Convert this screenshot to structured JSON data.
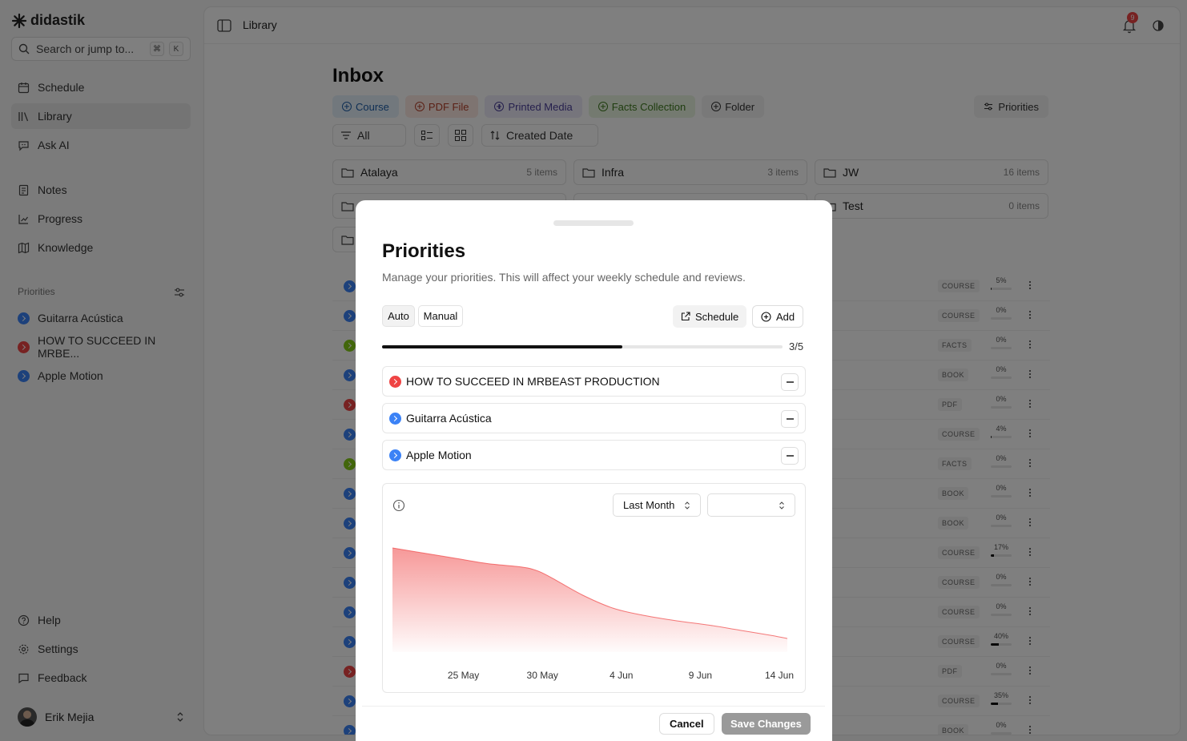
{
  "app": {
    "name": "didastik"
  },
  "sidebar": {
    "search_placeholder": "Search or jump to...",
    "shortcut": [
      "⌘",
      "K"
    ],
    "nav": [
      {
        "label": "Schedule"
      },
      {
        "label": "Library"
      },
      {
        "label": "Ask AI"
      },
      {
        "label": "Notes"
      },
      {
        "label": "Progress"
      },
      {
        "label": "Knowledge"
      }
    ],
    "priorities_label": "Priorities",
    "priorities": [
      {
        "label": "Guitarra Acústica",
        "color": "#3b82f6"
      },
      {
        "label": "HOW TO SUCCEED IN MRBE...",
        "color": "#ef4444"
      },
      {
        "label": "Apple Motion",
        "color": "#3b82f6"
      }
    ],
    "footer": [
      {
        "label": "Help"
      },
      {
        "label": "Settings"
      },
      {
        "label": "Feedback"
      }
    ],
    "user": {
      "name": "Erik Mejia"
    }
  },
  "main": {
    "breadcrumb": "Library",
    "notifications_count": "9",
    "title": "Inbox",
    "add_chips": [
      "Course",
      "PDF File",
      "Printed Media",
      "Facts Collection",
      "Folder"
    ],
    "priorities_button": "Priorities",
    "filter": {
      "label": "All",
      "sort": "Created Date"
    },
    "folders": [
      {
        "name": "Atalaya",
        "count": "5 items"
      },
      {
        "name": "Infra",
        "count": "3 items"
      },
      {
        "name": "JW",
        "count": "16 items"
      },
      {
        "name": "Test",
        "count": "0 items"
      }
    ],
    "rows": [
      {
        "tag": "COURSE",
        "pct": "5%",
        "progress": 5,
        "color": "#3b82f6"
      },
      {
        "tag": "COURSE",
        "pct": "0%",
        "progress": 0,
        "color": "#3b82f6"
      },
      {
        "tag": "FACTS",
        "pct": "0%",
        "progress": 0,
        "color": "#84cc16"
      },
      {
        "tag": "BOOK",
        "pct": "0%",
        "progress": 0,
        "color": "#3b82f6"
      },
      {
        "tag": "PDF",
        "pct": "0%",
        "progress": 0,
        "color": "#ef4444"
      },
      {
        "tag": "COURSE",
        "pct": "4%",
        "progress": 4,
        "color": "#3b82f6"
      },
      {
        "tag": "FACTS",
        "pct": "0%",
        "progress": 0,
        "color": "#84cc16"
      },
      {
        "tag": "BOOK",
        "pct": "0%",
        "progress": 0,
        "color": "#3b82f6"
      },
      {
        "tag": "BOOK",
        "pct": "0%",
        "progress": 0,
        "color": "#3b82f6"
      },
      {
        "tag": "COURSE",
        "pct": "17%",
        "progress": 17,
        "color": "#3b82f6"
      },
      {
        "tag": "COURSE",
        "pct": "0%",
        "progress": 0,
        "color": "#3b82f6"
      },
      {
        "tag": "COURSE",
        "pct": "0%",
        "progress": 0,
        "color": "#3b82f6"
      },
      {
        "tag": "COURSE",
        "pct": "40%",
        "progress": 40,
        "color": "#3b82f6"
      },
      {
        "tag": "PDF",
        "pct": "0%",
        "progress": 0,
        "color": "#ef4444"
      },
      {
        "tag": "COURSE",
        "pct": "35%",
        "progress": 35,
        "color": "#3b82f6"
      },
      {
        "tag": "BOOK",
        "pct": "0%",
        "progress": 0,
        "color": "#3b82f6"
      }
    ]
  },
  "modal": {
    "title": "Priorities",
    "description": "Manage your priorities. This will affect your weekly schedule and reviews.",
    "mode_auto": "Auto",
    "mode_manual": "Manual",
    "schedule_button": "Schedule",
    "add_button": "Add",
    "progress_fraction": 0.6,
    "progress_label": "3/5",
    "items": [
      {
        "label": "HOW TO SUCCEED IN MRBEAST PRODUCTION",
        "color": "#ef4444"
      },
      {
        "label": "Guitarra Acústica",
        "color": "#3b82f6"
      },
      {
        "label": "Apple Motion",
        "color": "#3b82f6"
      }
    ],
    "range_select": "Last Month",
    "second_select": "",
    "cancel": "Cancel",
    "save": "Save Changes"
  },
  "chart_data": {
    "type": "area",
    "x_ticks": [
      "25 May",
      "30 May",
      "4 Jun",
      "9 Jun",
      "14 Jun"
    ],
    "x_day_offsets": [
      0,
      5,
      10,
      15,
      20
    ],
    "x": [
      -5,
      -3,
      -1,
      1,
      3,
      4,
      5,
      7,
      9,
      11,
      13,
      15,
      17,
      19,
      20
    ],
    "y": [
      100,
      95,
      90,
      85,
      82,
      79,
      72,
      55,
      42,
      35,
      30,
      26,
      21,
      16,
      13
    ],
    "color": "#ef4444",
    "ylim": [
      0,
      100
    ]
  }
}
